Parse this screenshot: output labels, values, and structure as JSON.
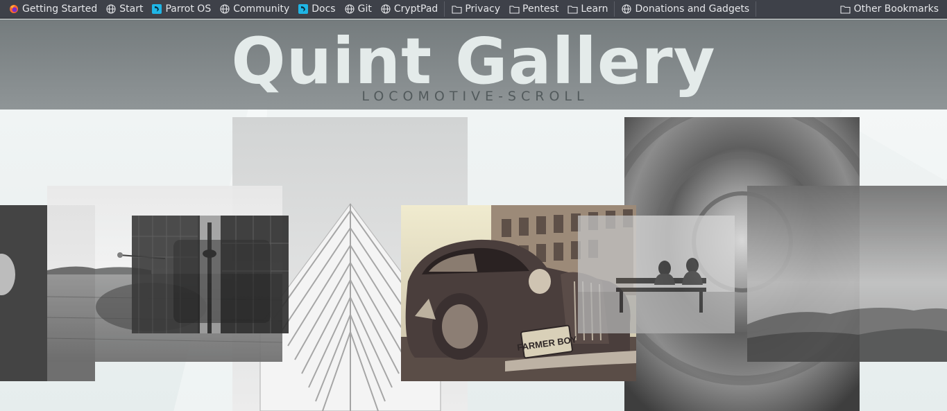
{
  "bookmarks_toolbar": {
    "items": [
      {
        "label": "Getting Started",
        "icon": "firefox-icon"
      },
      {
        "label": "Start",
        "icon": "globe-icon"
      },
      {
        "label": "Parrot OS",
        "icon": "parrot-icon"
      },
      {
        "label": "Community",
        "icon": "globe-icon"
      },
      {
        "label": "Docs",
        "icon": "parrot-icon"
      },
      {
        "label": "Git",
        "icon": "globe-icon"
      },
      {
        "label": "CryptPad",
        "icon": "globe-icon"
      }
    ],
    "folders": [
      {
        "label": "Privacy",
        "icon": "folder-icon"
      },
      {
        "label": "Pentest",
        "icon": "folder-icon"
      },
      {
        "label": "Learn",
        "icon": "folder-icon"
      }
    ],
    "extra": {
      "label": "Donations and Gadgets",
      "icon": "globe-icon"
    },
    "other": {
      "label": "Other Bookmarks",
      "icon": "folder-icon"
    }
  },
  "page": {
    "title": "Quint Gallery",
    "subtitle": "LOCOMOTIVE-SCROLL"
  },
  "colors": {
    "toolbar_bg": "#3e4149",
    "toolbar_text": "#e6e7ea",
    "title": "#e4ebea",
    "subtitle": "#525a5c",
    "parrot_blue": "#1fb6e6",
    "firefox_orange": "#ff6a2a"
  },
  "gallery": {
    "photos": [
      {
        "name": "photo-portrait-dark"
      },
      {
        "name": "photo-field-grass"
      },
      {
        "name": "photo-city-tower"
      },
      {
        "name": "photo-architecture-facade"
      },
      {
        "name": "photo-vintage-car"
      },
      {
        "name": "photo-tunnel"
      },
      {
        "name": "photo-couple-bench"
      },
      {
        "name": "photo-hills"
      }
    ],
    "car_plate": "FARMER BOY"
  }
}
